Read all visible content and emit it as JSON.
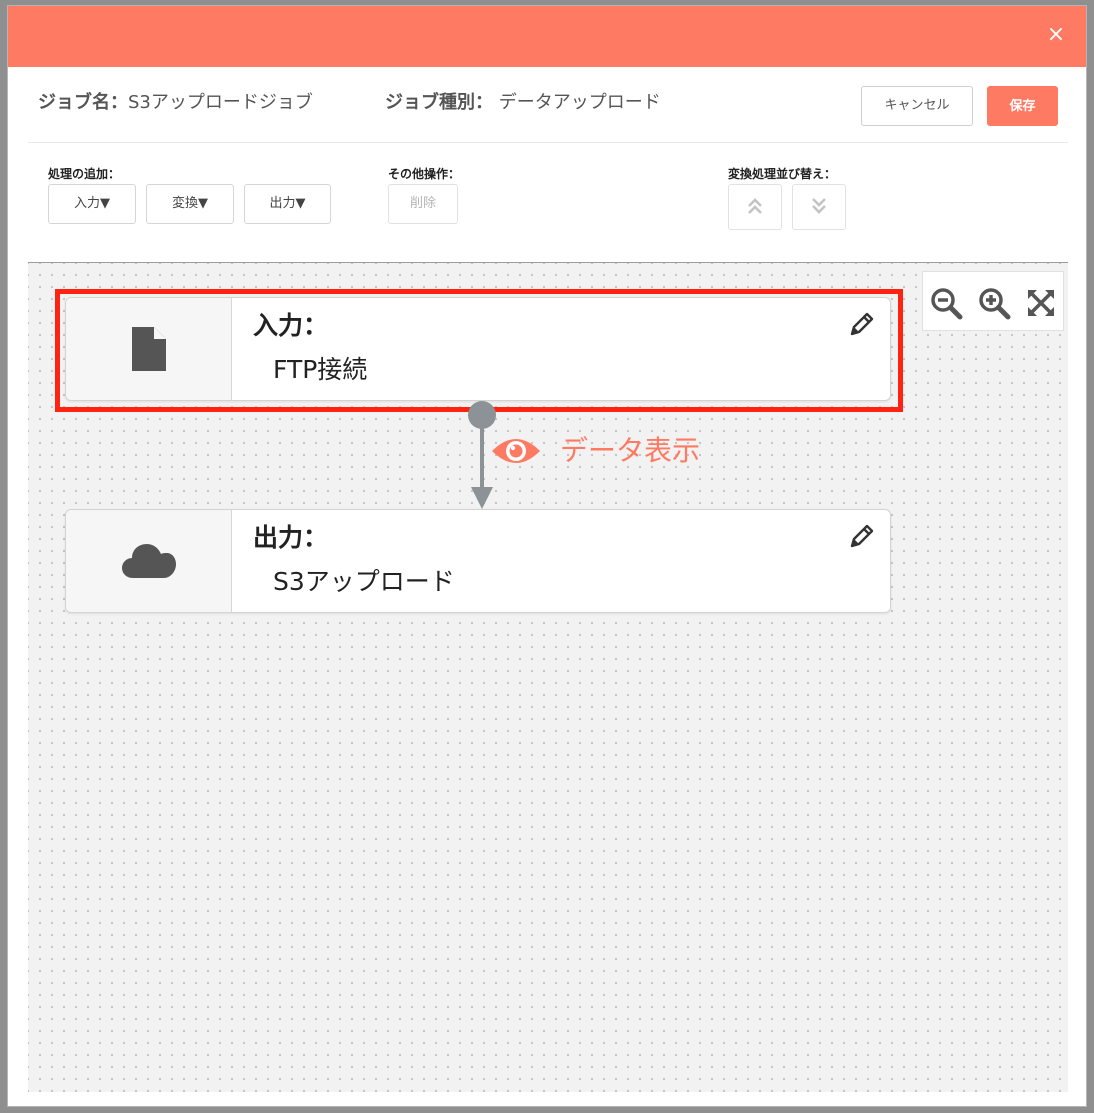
{
  "header": {
    "close_label": "×",
    "accent_color": "#ff7a63"
  },
  "job": {
    "name_label": "ジョブ名：",
    "name_value": "S3アップロードジョブ",
    "type_label": "ジョブ種別：",
    "type_value": "データアップロード"
  },
  "actions": {
    "cancel_label": "キャンセル",
    "save_label": "保存"
  },
  "toolbar": {
    "add_group_label": "処理の追加：",
    "add_buttons": [
      "入力▼",
      "変換▼",
      "出力▼"
    ],
    "other_group_label": "その他操作：",
    "delete_label": "削除",
    "sort_group_label": "変換処理並び替え：",
    "sort_up_icon": "double-chevron-up-icon",
    "sort_down_icon": "double-chevron-down-icon"
  },
  "zoom": {
    "icons": [
      "zoom-out-icon",
      "zoom-in-icon",
      "fit-screen-icon"
    ]
  },
  "nodes": [
    {
      "title": "入力：",
      "value": "FTP接続",
      "icon": "file-icon",
      "highlighted": true
    },
    {
      "title": "出力：",
      "value": "S3アップロード",
      "icon": "cloud-icon",
      "highlighted": false
    }
  ],
  "connector": {
    "preview_label": "データ表示",
    "preview_icon": "eye-icon"
  },
  "colors": {
    "highlight": "#ff2411",
    "preview_text": "#ff7a63"
  }
}
